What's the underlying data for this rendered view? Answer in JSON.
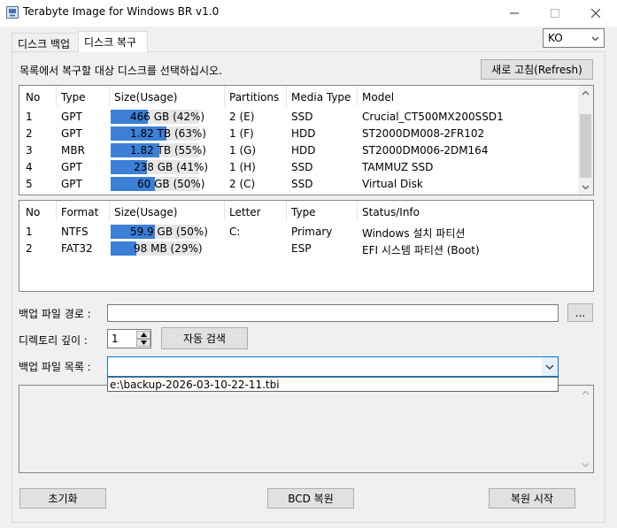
{
  "window": {
    "title": "Terabyte Image for Windows BR v1.0",
    "minimize_icon": "minimize-icon",
    "maximize_icon": "maximize-icon",
    "close_icon": "close-icon"
  },
  "tabs": [
    {
      "label": "디스크 백업",
      "active": false
    },
    {
      "label": "디스크 복구",
      "active": true
    }
  ],
  "language": {
    "selected": "KO"
  },
  "instruction": "목록에서 복구할 대상 디스크를 선택하십시오.",
  "refresh_button": "새로 고침(Refresh)",
  "disk_table": {
    "headers": [
      "No",
      "Type",
      "Size(Usage)",
      "Partitions",
      "Media Type",
      "Model"
    ],
    "rows": [
      {
        "no": "1",
        "type": "GPT",
        "size": "466 GB",
        "pct": "(42%)",
        "usage": 0.42,
        "partitions": "2 (E)",
        "media": "SSD",
        "model": "Crucial_CT500MX200SSD1"
      },
      {
        "no": "2",
        "type": "GPT",
        "size": "1.82 TB",
        "pct": "(63%)",
        "usage": 0.63,
        "partitions": "1 (F)",
        "media": "HDD",
        "model": "ST2000DM008-2FR102"
      },
      {
        "no": "3",
        "type": "MBR",
        "size": "1.82 TB",
        "pct": "(55%)",
        "usage": 0.55,
        "partitions": "1 (G)",
        "media": "HDD",
        "model": "ST2000DM006-2DM164"
      },
      {
        "no": "4",
        "type": "GPT",
        "size": "238 GB",
        "pct": "(41%)",
        "usage": 0.41,
        "partitions": "1 (H)",
        "media": "SSD",
        "model": "TAMMUZ SSD"
      },
      {
        "no": "5",
        "type": "GPT",
        "size": "60 GB",
        "pct": "(50%)",
        "usage": 0.5,
        "partitions": "2 (C)",
        "media": "SSD",
        "model": "Virtual Disk"
      }
    ]
  },
  "partition_table": {
    "headers": [
      "No",
      "Format",
      "Size(Usage)",
      "Letter",
      "Type",
      "Status/Info"
    ],
    "rows": [
      {
        "no": "1",
        "format": "NTFS",
        "size": "59.9 GB",
        "pct": "(50%)",
        "usage": 0.5,
        "letter": "C:",
        "type": "Primary",
        "status": "Windows 설치 파티션"
      },
      {
        "no": "2",
        "format": "FAT32",
        "size": "98 MB",
        "pct": "(29%)",
        "usage": 0.29,
        "letter": "",
        "type": "ESP",
        "status": "EFI 시스템 파티션 (Boot)"
      }
    ]
  },
  "backup_path": {
    "label": "백업 파일 경로 :",
    "value": "",
    "browse_label": "..."
  },
  "depth": {
    "label": "디렉토리 깊이 :",
    "value": "1",
    "auto_search_label": "자동 검색"
  },
  "backup_list": {
    "label": "백업 파일 목록 :",
    "value": "",
    "options": [
      "e:\\backup-2026-03-10-22-11.tbi"
    ]
  },
  "buttons": {
    "reset": "초기화",
    "bcd": "BCD 복원",
    "start": "복원 시작"
  },
  "colors": {
    "usage_bar": "#3c7fd6",
    "usage_track": "#e6e6e6",
    "focus": "#0078d7"
  }
}
